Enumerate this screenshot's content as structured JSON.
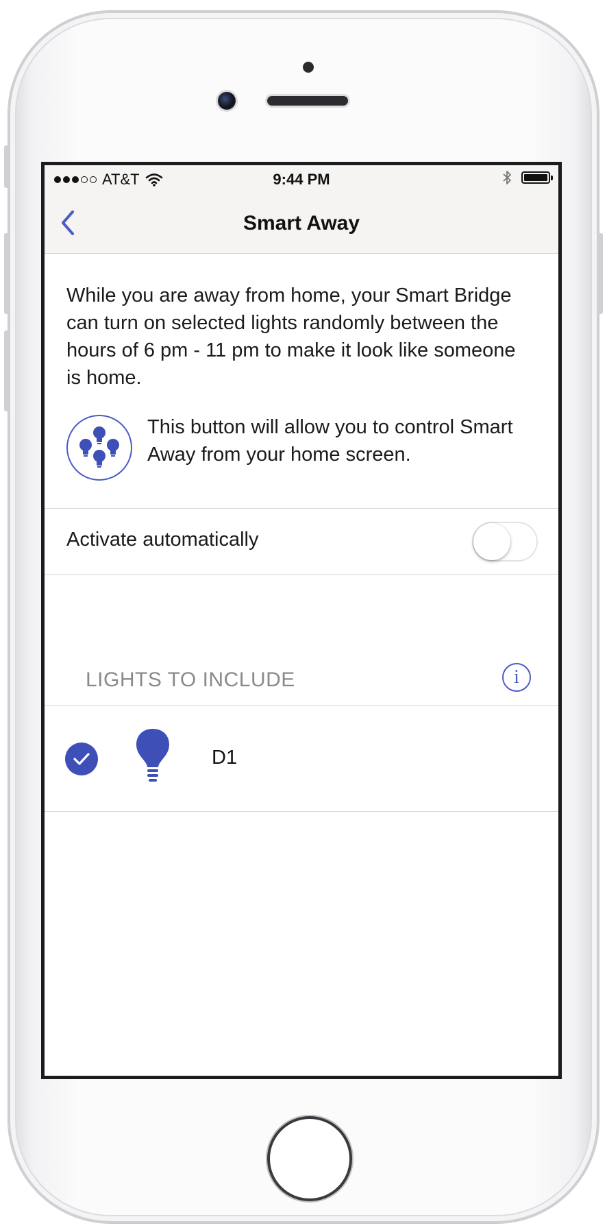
{
  "status_bar": {
    "carrier": "AT&T",
    "time": "9:44 PM",
    "signal_bars": 3,
    "signal_total": 5
  },
  "nav": {
    "title": "Smart Away",
    "back_icon": "chevron-left-icon"
  },
  "main": {
    "description": "While you are away from home, your Smart Bridge can turn on selected lights randomly between the hours of 6 pm - 11 pm to make it look like someone is home.",
    "widget_text": "This button will allow you to control Smart Away from your home screen.",
    "activate_label": "Activate automatically",
    "activate_on": false,
    "section_title": "LIGHTS TO INCLUDE",
    "info_glyph": "i",
    "lights": [
      {
        "name": "D1",
        "selected": true
      }
    ]
  },
  "colors": {
    "accent": "#3e50b8",
    "nav_background": "#f5f4f2",
    "section_text": "#8a8a8a"
  }
}
